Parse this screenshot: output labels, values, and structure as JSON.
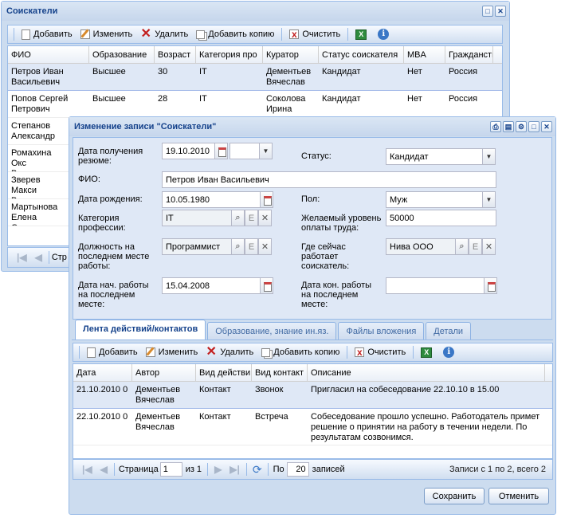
{
  "back_window": {
    "title": "Соискатели",
    "toolbar": [
      "Добавить",
      "Изменить",
      "Удалить",
      "Добавить копию",
      "Очистить"
    ],
    "columns": [
      "ФИО",
      "Образование",
      "Возраст",
      "Категория про",
      "Куратор",
      "Статус соискателя",
      "MBA",
      "Гражданств"
    ],
    "rows": [
      {
        "name": "Петров Иван Васильевич",
        "edu": "Высшее",
        "age": "30",
        "cat": "IT",
        "cur": "Дементьев Вячеслав",
        "status": "Кандидат",
        "mba": "Нет",
        "cit": "Россия"
      },
      {
        "name": "Попов Сергей Петрович",
        "edu": "Высшее",
        "age": "28",
        "cat": "IT",
        "cur": "Соколова Ирина",
        "status": "Кандидат",
        "mba": "Нет",
        "cit": "Россия"
      },
      {
        "name": "Степанов Александр",
        "edu": "",
        "age": "",
        "cat": "",
        "cur": "",
        "status": "",
        "mba": "",
        "cit": ""
      },
      {
        "name": "Ромахина Окс Васильевна",
        "edu": "",
        "age": "",
        "cat": "",
        "cur": "",
        "status": "",
        "mba": "",
        "cit": ""
      },
      {
        "name": "Зверев Макси Викторович",
        "edu": "",
        "age": "",
        "cat": "",
        "cur": "",
        "status": "",
        "mba": "",
        "cit": ""
      },
      {
        "name": "Мартынова Елена Сергее",
        "edu": "",
        "age": "",
        "cat": "",
        "cur": "",
        "status": "",
        "mba": "",
        "cit": ""
      }
    ],
    "pager_text": "Стр"
  },
  "edit_window": {
    "title": "Изменение записи \"Соискатели\"",
    "form": {
      "resume_date_label": "Дата получения резюме:",
      "resume_date": "19.10.2010",
      "status_label": "Статус:",
      "status": "Кандидат",
      "fio_label": "ФИО:",
      "fio": "Петров Иван Васильевич",
      "birth_label": "Дата рождения:",
      "birth": "10.05.1980",
      "sex_label": "Пол:",
      "sex": "Муж",
      "category_label": "Категория профессии:",
      "category": "IT",
      "salary_label": "Желаемый уровень оплаты труда:",
      "salary": "50000",
      "position_label": "Должность на последнем месте работы:",
      "position": "Программист",
      "company_label": "Где сейчас работает соискатель:",
      "company": "Нива ООО",
      "start_label": "Дата нач. работы на последнем месте:",
      "start": "15.04.2008",
      "end_label": "Дата кон. работы на последнем месте:",
      "end": ""
    },
    "tabs": [
      "Лента действий/контактов",
      "Образование, знание ин.яз.",
      "Файлы вложения",
      "Детали"
    ],
    "toolbar": [
      "Добавить",
      "Изменить",
      "Удалить",
      "Добавить копию",
      "Очистить"
    ],
    "columns": [
      "Дата",
      "Автор",
      "Вид действи",
      "Вид контакт",
      "Описание"
    ],
    "rows": [
      {
        "date": "21.10.2010 0",
        "author": "Дементьев Вячеслав",
        "action": "Контакт",
        "contact": "Звонок",
        "desc": "Пригласил на собеседование 22.10.10 в 15.00"
      },
      {
        "date": "22.10.2010 0",
        "author": "Дементьев Вячеслав",
        "action": "Контакт",
        "contact": "Встреча",
        "desc": "Собеседование прошло успешно. Работодатель примет решение о принятии на работу в течении недели. По результатам созвонимся."
      }
    ],
    "pager": {
      "page_label": "Страница",
      "page": "1",
      "of": "из 1",
      "per_label": "По",
      "per": "20",
      "records": "записей",
      "summary": "Записи с 1 по 2, всего 2"
    },
    "save": "Сохранить",
    "cancel": "Отменить"
  }
}
